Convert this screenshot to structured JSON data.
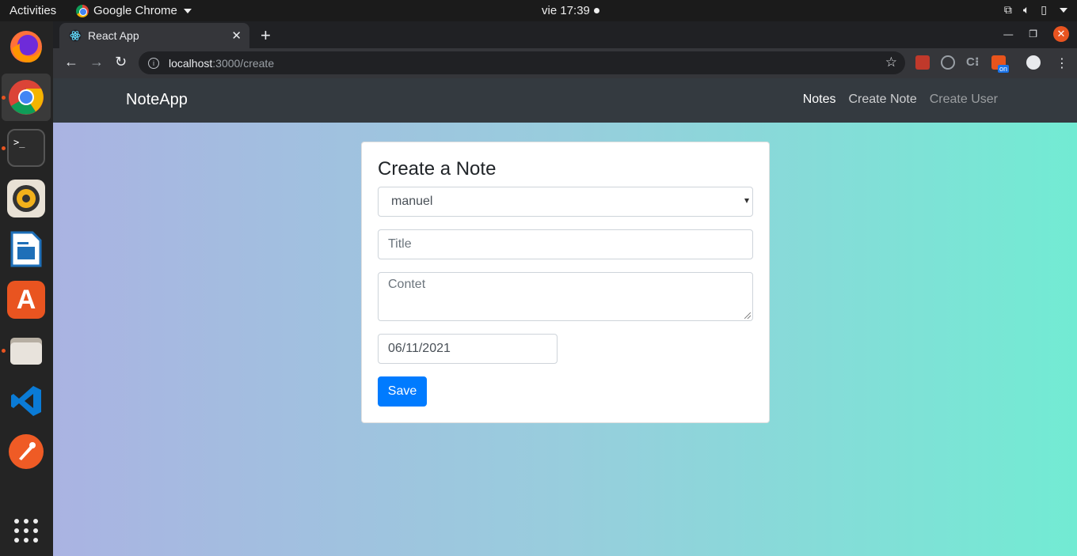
{
  "os": {
    "activities": "Activities",
    "app_name": "Google Chrome",
    "clock": "vie 17:39"
  },
  "browser": {
    "tab_title": "React App",
    "url_host": "localhost",
    "url_path": ":3000/create"
  },
  "app": {
    "brand": "NoteApp",
    "nav": [
      {
        "label": "Notes",
        "state": "active"
      },
      {
        "label": "Create Note",
        "state": "normal"
      },
      {
        "label": "Create User",
        "state": "muted"
      }
    ]
  },
  "form": {
    "heading": "Create a Note",
    "user_select_value": "manuel",
    "title_placeholder": "Title",
    "content_placeholder": "Contet",
    "date_value": "06/11/2021",
    "save_label": "Save"
  },
  "colors": {
    "primary": "#007bff",
    "navbar": "#343a40",
    "gradient_left": "#aab3e2",
    "gradient_right": "#72ebd3"
  }
}
